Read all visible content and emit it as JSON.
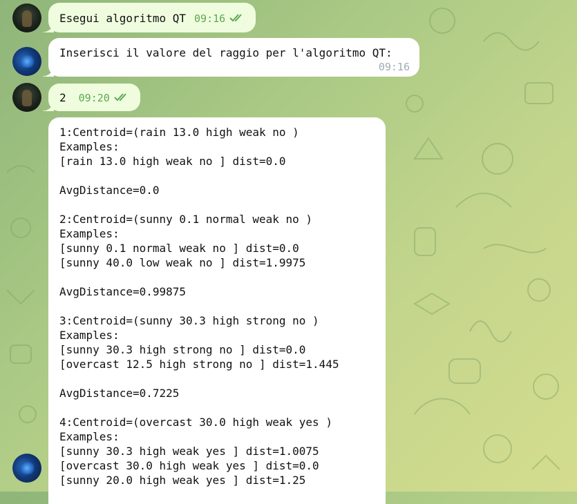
{
  "messages": [
    {
      "sender": "user",
      "text": "Esegui algoritmo QT",
      "time": "09:16",
      "status": "read"
    },
    {
      "sender": "bot",
      "text": "Inserisci il valore del raggio per l'algoritmo QT:",
      "time": "09:16"
    },
    {
      "sender": "user",
      "text": "2",
      "time": "09:20",
      "status": "read"
    },
    {
      "sender": "bot",
      "lines": [
        "1:Centroid=(rain 13.0 high weak no )",
        "Examples:",
        "[rain 13.0 high weak no ] dist=0.0",
        "",
        "AvgDistance=0.0",
        "",
        "2:Centroid=(sunny 0.1 normal weak no )",
        "Examples:",
        "[sunny 0.1 normal weak no ] dist=0.0",
        "[sunny 40.0 low weak no ] dist=1.9975",
        "",
        "AvgDistance=0.99875",
        "",
        "3:Centroid=(sunny 30.3 high strong no )",
        "Examples:",
        "[sunny 30.3 high strong no ] dist=0.0",
        "[overcast 12.5 high strong no ] dist=1.445",
        "",
        "AvgDistance=0.7225",
        "",
        "4:Centroid=(overcast 30.0 high weak yes )",
        "Examples:",
        "[sunny 30.3 high weak yes ] dist=1.0075",
        "[overcast 30.0 high weak yes ] dist=0.0",
        "[sunny 20.0 high weak yes ] dist=1.25"
      ]
    }
  ],
  "colors": {
    "outgoing_bubble": "#effdde",
    "incoming_bubble": "#ffffff",
    "outgoing_time": "#5ca853",
    "incoming_time": "#a0acb6",
    "wallpaper": "#b5cf86"
  },
  "icons": {
    "read_status": "double-check-icon",
    "user_avatar": "avatar-user",
    "bot_avatar": "avatar-bot"
  }
}
